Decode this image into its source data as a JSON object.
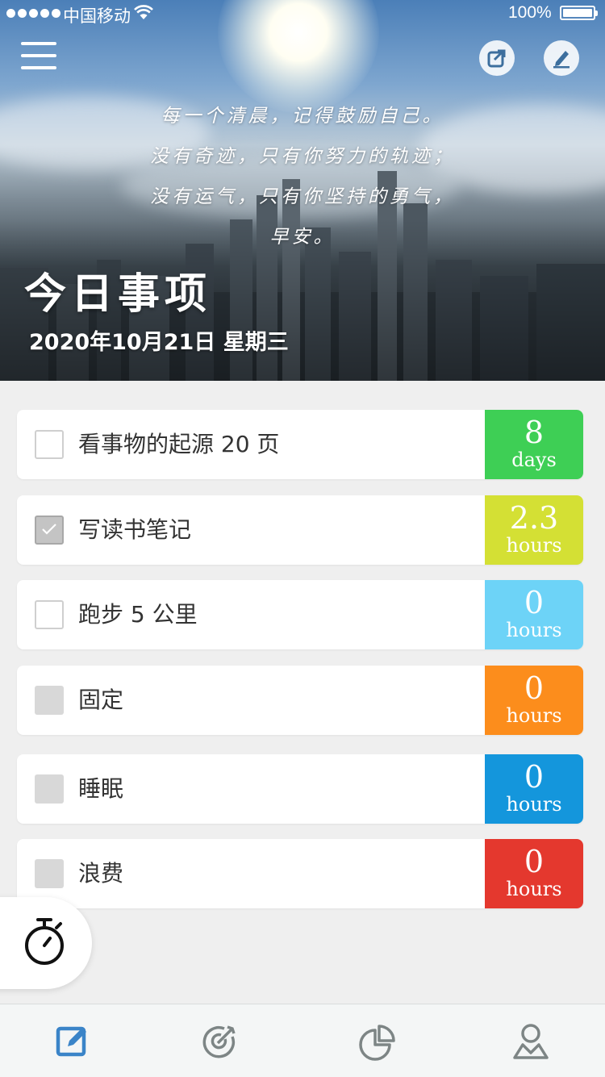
{
  "status_bar": {
    "carrier": "中国移动",
    "battery": "100%",
    "signal_bars": 5
  },
  "header": {
    "menu_icon": "hamburger-menu-icon",
    "share_icon": "share-icon",
    "edit_icon": "pencil-icon",
    "quote_lines": [
      "每一个清晨，记得鼓励自己。",
      "没有奇迹，只有你努力的轨迹；",
      "没有运气，只有你坚持的勇气，",
      "早安。"
    ],
    "title": "今日事项",
    "date": "2020年10月21日 星期三"
  },
  "tasks": [
    {
      "label": "看事物的起源 20 页",
      "value": "8",
      "unit": "days",
      "checkbox": "empty",
      "color": "#3ecf55"
    },
    {
      "label": "写读书笔记",
      "value": "2.3",
      "unit": "hours",
      "checkbox": "checked",
      "color": "#d4e034"
    },
    {
      "label": "跑步 5 公里",
      "value": "0",
      "unit": "hours",
      "checkbox": "empty",
      "color": "#6dd3f7"
    },
    {
      "label": "固定",
      "value": "0",
      "unit": "hours",
      "checkbox": "gray",
      "color": "#fc8d1c"
    },
    {
      "label": "睡眠",
      "value": "0",
      "unit": "hours",
      "checkbox": "gray",
      "color": "#1496dc"
    },
    {
      "label": "浪费",
      "value": "0",
      "unit": "hours",
      "checkbox": "gray",
      "color": "#e4382e"
    }
  ],
  "timer_button": {
    "icon": "stopwatch-icon"
  },
  "tab_bar": {
    "active_color": "#3a84c8",
    "inactive_color": "#7d8585",
    "tabs": [
      {
        "icon": "edit-icon",
        "active": true
      },
      {
        "icon": "target-icon",
        "active": false
      },
      {
        "icon": "pie-chart-icon",
        "active": false
      },
      {
        "icon": "profile-icon",
        "active": false
      }
    ]
  }
}
